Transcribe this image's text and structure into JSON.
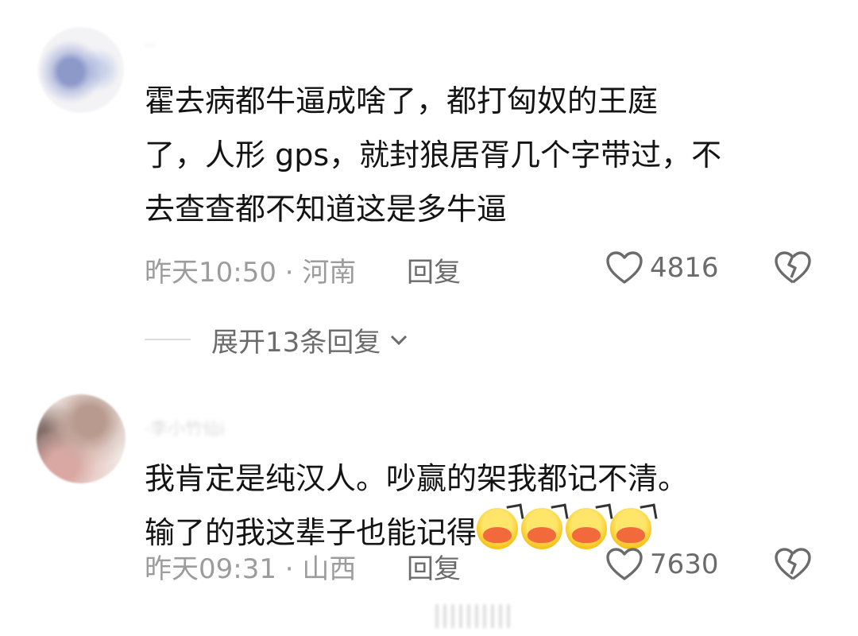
{
  "comments": [
    {
      "username": "··",
      "text": "霍去病都牛逼成啥了，都打匈奴的王庭\n了，人形 gps，就封狼居胥几个字带过，不\n去查查都不知道这是多牛逼",
      "time_location": "昨天10:50 · 河南",
      "reply_label": "回复",
      "likes": "4816",
      "expand_label": "展开13条回复"
    },
    {
      "username": "·李小竹仙i",
      "text_line1": "我肯定是纯汉人。吵赢的架我都记不清。",
      "text_line2": "输了的我这辈子也能记得",
      "emoji_count": 4,
      "emoji_name": "laughing-cry-emoji",
      "time_location": "昨天09:31 · 山西",
      "reply_label": "回复",
      "likes": "7630"
    }
  ],
  "colors": {
    "text": "#141414",
    "meta": "#9c9c9c",
    "action": "#6b6b6b",
    "background": "#ffffff"
  }
}
